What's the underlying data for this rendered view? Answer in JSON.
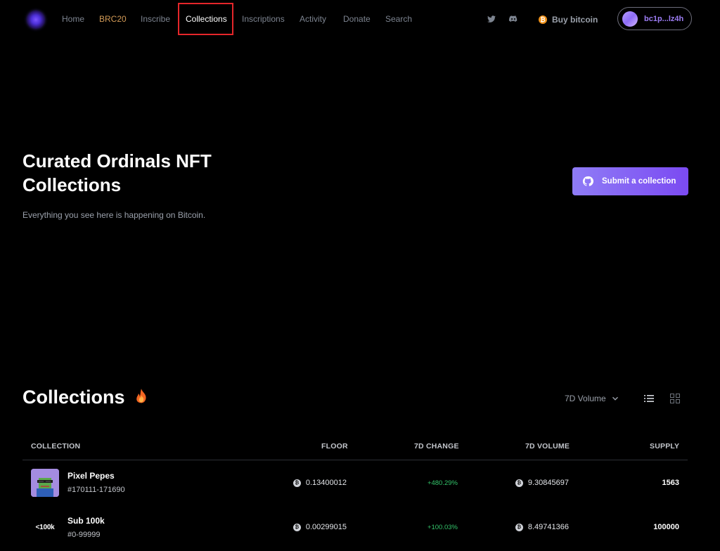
{
  "nav": {
    "links": [
      "Home",
      "BRC20",
      "Inscribe",
      "Collections",
      "Inscriptions",
      "Activity",
      "Donate",
      "Search"
    ],
    "active": "Collections",
    "buy_label": "Buy bitcoin",
    "wallet_address": "bc1p...lz4h",
    "social_icons": [
      "twitter-icon",
      "discord-icon"
    ]
  },
  "hero": {
    "title": "Curated Ordinals NFT Collections",
    "subtitle": "Everything you see here is happening on Bitcoin.",
    "submit_label": "Submit a collection"
  },
  "collections": {
    "title": "Collections",
    "sort_label": "7D Volume",
    "columns": [
      "COLLECTION",
      "FLOOR",
      "7D CHANGE",
      "7D VOLUME",
      "SUPPLY"
    ],
    "rows": [
      {
        "name": "Pixel Pepes",
        "range": "#170111-171690",
        "floor": "0.13400012",
        "change": "+480.29%",
        "volume": "9.30845697",
        "supply": "1563",
        "thumb_text": ""
      },
      {
        "name": "Sub 100k",
        "range": "#0-99999",
        "floor": "0.00299015",
        "change": "+100.03%",
        "volume": "8.49741366",
        "supply": "100000",
        "thumb_text": "<100k"
      }
    ]
  },
  "colors": {
    "accent": "#7b4af2",
    "brc20": "#d29a56",
    "positive": "#33c46a",
    "highlight": "#e5262a"
  }
}
